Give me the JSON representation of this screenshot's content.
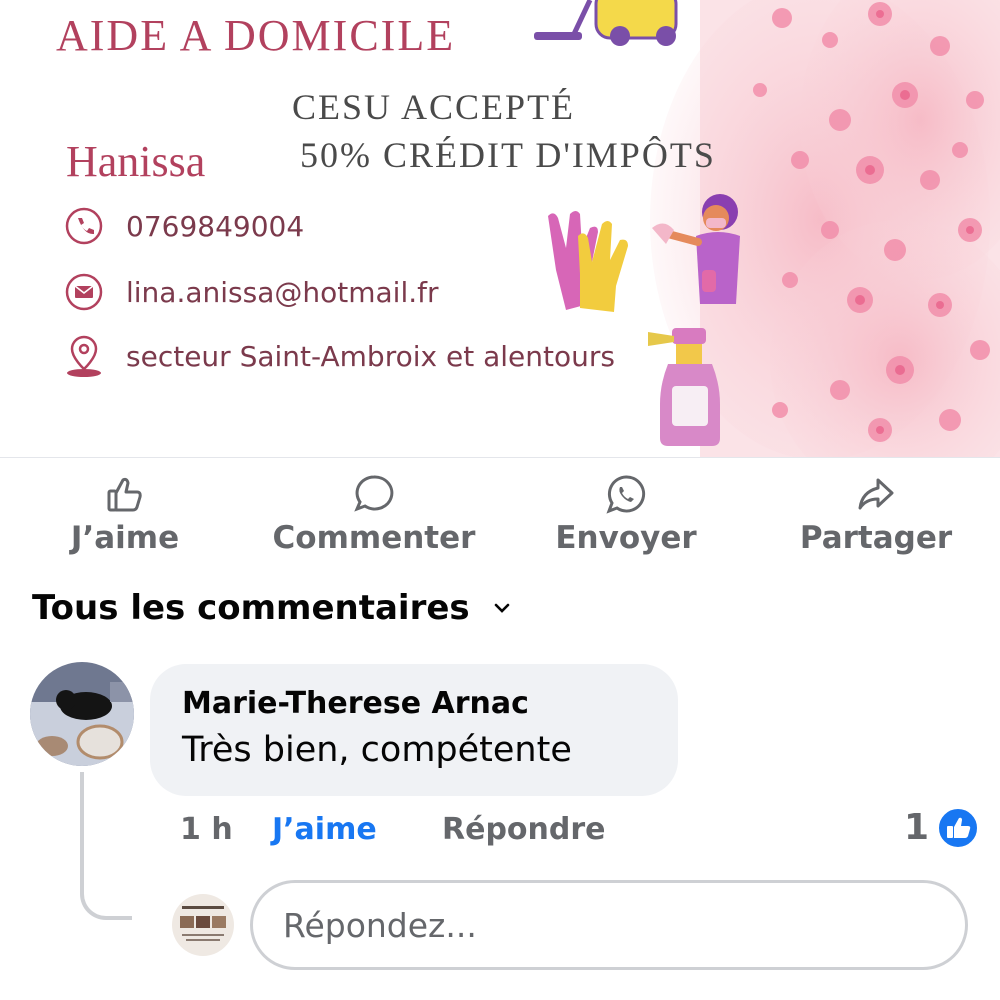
{
  "post_image": {
    "title": "AIDE A DOMICILE",
    "line1": "CESU ACCEPTÉ",
    "line2": "50% CRÉDIT D'IMPÔTS",
    "name": "Hanissa",
    "phone": "0769849004",
    "email": "lina.anissa@hotmail.fr",
    "area": "secteur Saint-Ambroix et alentours",
    "icons": [
      "phone-icon",
      "mail-icon",
      "location-pin-icon",
      "vacuum-icon",
      "gloves-icon",
      "cleaner-person-icon",
      "spray-bottle-icon"
    ],
    "colors": {
      "accent": "#b2415e",
      "text": "#4a4a4a",
      "pink_flowers": "#f28fab"
    }
  },
  "actions": [
    {
      "label": "J’aime",
      "icon": "thumbs-up-icon"
    },
    {
      "label": "Commenter",
      "icon": "comment-bubble-icon"
    },
    {
      "label": "Envoyer",
      "icon": "whatsapp-icon"
    },
    {
      "label": "Partager",
      "icon": "share-arrow-icon"
    }
  ],
  "comments_section": {
    "title": "Tous les commentaires",
    "sort_icon": "chevron-down-icon"
  },
  "comment": {
    "author": "Marie-Therese Arnac",
    "text": "Très bien, compétente",
    "time": "1 h",
    "like_label": "J’aime",
    "reply_label": "Répondre",
    "reaction_count": "1",
    "reaction_icon": "like-reaction-icon"
  },
  "reply_box": {
    "placeholder": "Répondez..."
  },
  "colors": {
    "like_blue": "#1877f2",
    "secondary_text": "#65676b",
    "bubble_bg": "#f0f2f5"
  }
}
